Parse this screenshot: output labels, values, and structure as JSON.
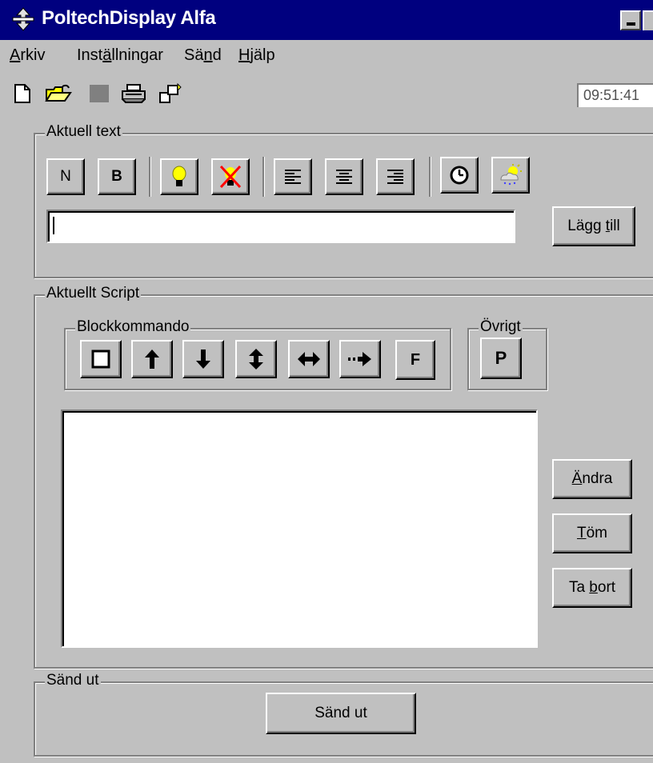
{
  "window": {
    "title": "PoltechDisplay Alfa"
  },
  "menu": [
    {
      "accel": "A",
      "rest": "rkiv"
    },
    {
      "pre": "Inst",
      "accel": "ä",
      "rest": "llningar"
    },
    {
      "pre": "Sä",
      "accel": "n",
      "rest": "d"
    },
    {
      "accel": "H",
      "rest": "jälp"
    }
  ],
  "toolbar": {
    "icons": [
      "new-file-icon",
      "open-folder-icon",
      "disabled-save-icon",
      "printer-icon",
      "connect-icon"
    ],
    "clock": "09:51:41"
  },
  "aktuell_text": {
    "legend": "Aktuell text",
    "buttons": {
      "normal": "N",
      "bold": "B"
    },
    "icons": [
      "lamp-on-icon",
      "lamp-off-icon",
      "align-left-icon",
      "align-center-icon",
      "align-right-icon",
      "clock-icon",
      "weather-icon"
    ],
    "input_value": "",
    "add_button": {
      "pre": "Lägg ",
      "accel": "t",
      "rest": "ill"
    }
  },
  "aktuellt_script": {
    "legend": "Aktuellt Script",
    "block_group": {
      "legend": "Blockkommando",
      "icons": [
        "block-square-icon",
        "arrow-up-icon",
        "arrow-down-icon",
        "arrow-up-down-icon",
        "arrow-left-right-icon",
        "arrow-dotted-right-icon"
      ],
      "f_label": "F"
    },
    "other_group": {
      "legend": "Övrigt",
      "p_label": "P"
    },
    "buttons": {
      "change": {
        "accel": "Ä",
        "rest": "ndra"
      },
      "clear": {
        "accel": "T",
        "rest": "öm"
      },
      "remove": {
        "pre": "Ta ",
        "accel": "b",
        "rest": "ort"
      }
    }
  },
  "send": {
    "legend": "Sänd ut",
    "button": "Sänd ut"
  },
  "colors": {
    "titlebar": "#00007f",
    "face": "#c0c0c0",
    "lamp": "#ffff00",
    "cross": "#ff0000"
  }
}
